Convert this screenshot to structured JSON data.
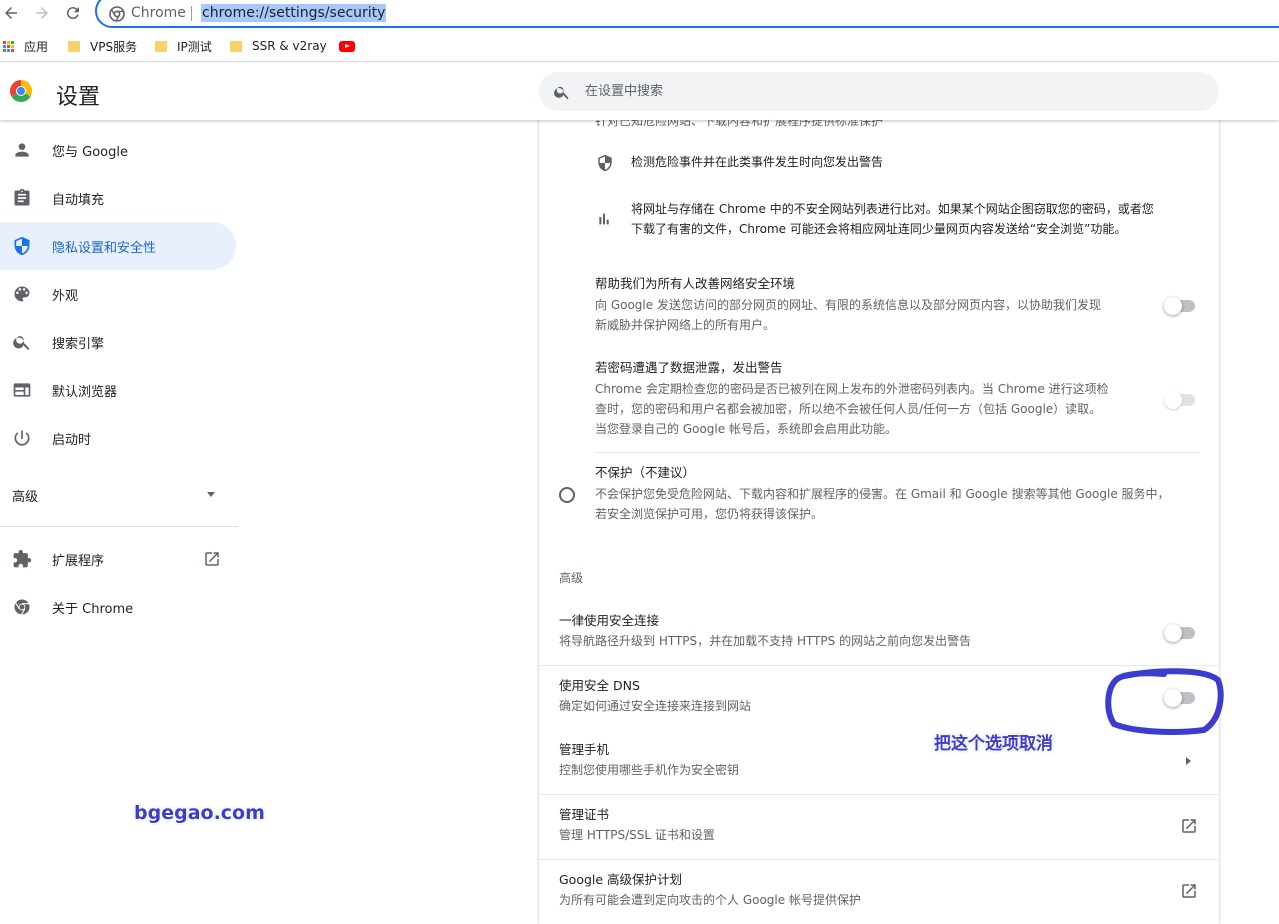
{
  "browser": {
    "omnibox_label": "Chrome",
    "url": "chrome://settings/security"
  },
  "bookmarks": [
    {
      "label": "应用",
      "icon": "apps-grid-icon"
    },
    {
      "label": "VPS服务",
      "icon": "folder-icon"
    },
    {
      "label": "IP测试",
      "icon": "folder-icon"
    },
    {
      "label": "SSR & v2ray",
      "icon": "folder-icon"
    },
    {
      "label": "",
      "icon": "youtube-icon"
    }
  ],
  "header": {
    "title": "设置",
    "search_placeholder": "在设置中搜索"
  },
  "sidebar": {
    "items": [
      {
        "label": "您与 Google",
        "icon": "person-icon"
      },
      {
        "label": "自动填充",
        "icon": "clipboard-icon"
      },
      {
        "label": "隐私设置和安全性",
        "icon": "shield-icon",
        "active": true
      },
      {
        "label": "外观",
        "icon": "palette-icon"
      },
      {
        "label": "搜索引擎",
        "icon": "search-icon"
      },
      {
        "label": "默认浏览器",
        "icon": "browser-window-icon"
      },
      {
        "label": "启动时",
        "icon": "power-icon"
      }
    ],
    "advanced_label": "高级",
    "extensions_label": "扩展程序",
    "about_label": "关于 Chrome"
  },
  "main": {
    "clipped_top_text": "针对已知危险网站、下载内容和扩展程序提供标准保护",
    "bullet1": "检测危险事件并在此类事件发生时向您发出警告",
    "bullet2_line1": "将网址与存储在 Chrome 中的不安全网站列表进行比对。如果某个网站企图窃取您的密码，或者您",
    "bullet2_line2": "下载了有害的文件，Chrome 可能还会将相应网址连同少量网页内容发送给“安全浏览”功能。",
    "help_title": "帮助我们为所有人改善网络安全环境",
    "help_desc_line1": "向 Google 发送您访问的部分网页的网址、有限的系统信息以及部分网页内容，以协助我们发现",
    "help_desc_line2": "新威胁并保护网络上的所有用户。",
    "pw_title": "若密码遭遇了数据泄露，发出警告",
    "pw_desc_line1": "Chrome 会定期检查您的密码是否已被列在网上发布的外泄密码列表内。当 Chrome 进行这项检",
    "pw_desc_line2": "查时，您的密码和用户名都会被加密，所以绝不会被任何人员/任何一方（包括 Google）读取。",
    "pw_desc_line3": "当您登录自己的 Google 帐号后，系统即会启用此功能。",
    "noprot_title": "不保护（不建议）",
    "noprot_desc_line1": "不会保护您免受危险网站、下载内容和扩展程序的侵害。在 Gmail 和 Google 搜索等其他 Google 服务中，",
    "noprot_desc_line2": "若安全浏览保护可用，您仍将获得该保护。",
    "advanced_heading": "高级",
    "https_title": "一律使用安全连接",
    "https_desc": "将导航路径升级到 HTTPS，并在加载不支持 HTTPS 的网站之前向您发出警告",
    "dns_title": "使用安全 DNS",
    "dns_desc": "确定如何通过安全连接来连接到网站",
    "phone_title": "管理手机",
    "phone_desc": "控制您使用哪些手机作为安全密钥",
    "cert_title": "管理证书",
    "cert_desc": "管理 HTTPS/SSL 证书和设置",
    "gapp_title": "Google 高级保护计划",
    "gapp_desc": "为所有可能会遭到定向攻击的个人 Google 帐号提供保护"
  },
  "annotations": {
    "watermark": "bgegao.com",
    "instruction": "把这个选项取消"
  },
  "colors": {
    "accent": "#1a73e8",
    "active_bg": "#e8f0fe",
    "annotation": "#3c3ccf"
  }
}
